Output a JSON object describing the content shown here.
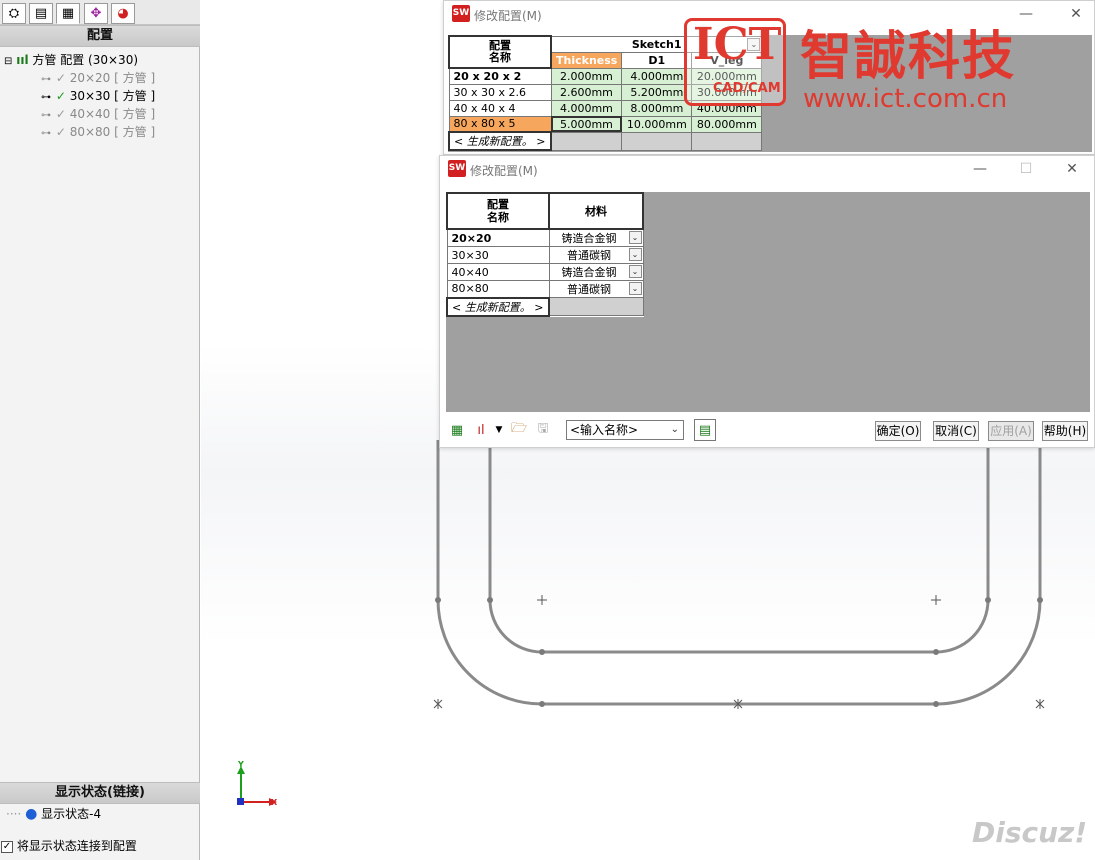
{
  "feature_manager": {
    "tabs": [
      "feature-tree",
      "property-manager",
      "configuration-manager",
      "dimxpert",
      "display-manager"
    ],
    "section_title": "配置",
    "root": {
      "label": "方管 配置",
      "suffix": "(30×30)"
    },
    "configs": [
      {
        "name": "20×20",
        "tag": "[ 方管 ]",
        "active": false
      },
      {
        "name": "30×30",
        "tag": "[ 方管 ]",
        "active": true
      },
      {
        "name": "40×40",
        "tag": "[ 方管 ]",
        "active": false
      },
      {
        "name": "80×80",
        "tag": "[ 方管 ]",
        "active": false
      }
    ],
    "display_state_title": "显示状态(链接)",
    "display_state_item": "显示状态-4",
    "link_checkbox_label": "将显示状态连接到配置",
    "link_checkbox_checked": true
  },
  "dialog1": {
    "title": "修改配置(M)",
    "header_name": "配置\n名称",
    "group_header": "Sketch1",
    "params": [
      "Thickness",
      "D1",
      "V_leg"
    ],
    "rows": [
      {
        "name": "20 x 20 x 2",
        "values": [
          "2.000mm",
          "4.000mm",
          "20.000mm"
        ]
      },
      {
        "name": "30 x 30 x 2.6",
        "values": [
          "2.600mm",
          "5.200mm",
          "30.000mm"
        ]
      },
      {
        "name": "40 x 40 x 4",
        "values": [
          "4.000mm",
          "8.000mm",
          "40.000mm"
        ]
      },
      {
        "name": "80 x 80 x 5",
        "values": [
          "5.000mm",
          "10.000mm",
          "80.000mm"
        ]
      }
    ],
    "new_config_label": "< 生成新配置。 >"
  },
  "dialog2": {
    "title": "修改配置(M)",
    "header_name": "配置\n名称",
    "material_header": "材料",
    "rows": [
      {
        "name": "20×20",
        "material": "铸造合金钢"
      },
      {
        "name": "30×30",
        "material": "普通碳钢"
      },
      {
        "name": "40×40",
        "material": "铸造合金钢"
      },
      {
        "name": "80×80",
        "material": "普通碳钢"
      }
    ],
    "new_config_label": "< 生成新配置。 >",
    "name_combo_value": "<输入名称>",
    "buttons": {
      "ok": "确定(O)",
      "cancel": "取消(C)",
      "apply": "应用(A)",
      "help": "帮助(H)"
    }
  },
  "watermarks": {
    "logo_letters": "ICT",
    "logo_sub": "CAD/CAM",
    "company": "智誠科技",
    "url": "www.ict.com.cn",
    "forum": "Discuz!"
  },
  "triad": {
    "y_label": "Y",
    "x_label": "X"
  },
  "colors": {
    "accent_orange": "#f6a75d",
    "value_green": "#d7f0d3",
    "watermark_red": "#e0392f",
    "sketch_grey": "#8a8a8a"
  }
}
